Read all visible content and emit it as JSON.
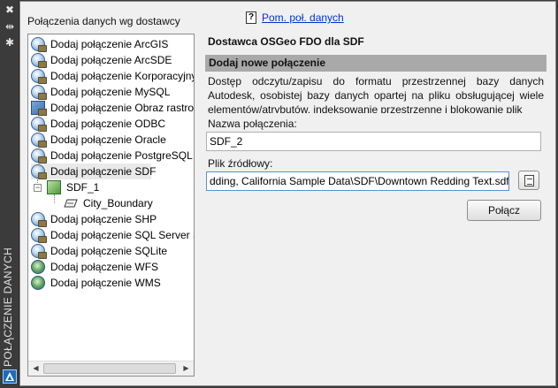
{
  "sidebar_strip": {
    "title": "POŁĄCZENIE DANYCH",
    "icons": [
      "close-icon",
      "auto-hide-icon",
      "settings-icon",
      "autodesk-logo-icon"
    ]
  },
  "tree_panel": {
    "header": "Połączenia danych wg dostawcy",
    "items": [
      {
        "label": "Dodaj połączenie ArcGIS",
        "icon": "database-icon"
      },
      {
        "label": "Dodaj połączenie ArcSDE",
        "icon": "database-icon"
      },
      {
        "label": "Dodaj połączenie Korporacyjny",
        "icon": "database-icon"
      },
      {
        "label": "Dodaj połączenie MySQL",
        "icon": "database-icon"
      },
      {
        "label": "Dodaj połączenie Obraz rastrowy",
        "icon": "raster-icon"
      },
      {
        "label": "Dodaj połączenie ODBC",
        "icon": "database-icon"
      },
      {
        "label": "Dodaj połączenie Oracle",
        "icon": "database-icon"
      },
      {
        "label": "Dodaj połączenie PostgreSQL",
        "icon": "database-icon"
      },
      {
        "label": "Dodaj połączenie SDF",
        "icon": "database-icon",
        "selected": true
      },
      {
        "label": "SDF_1",
        "icon": "sdf-connection-icon",
        "level": 1,
        "expanded": true
      },
      {
        "label": "City_Boundary",
        "icon": "polygon-layer-icon",
        "level": 2
      },
      {
        "label": "Dodaj połączenie SHP",
        "icon": "database-icon"
      },
      {
        "label": "Dodaj połączenie SQL Server Spatial",
        "icon": "database-icon"
      },
      {
        "label": "Dodaj połączenie SQLite",
        "icon": "database-icon"
      },
      {
        "label": "Dodaj połączenie WFS",
        "icon": "globe-icon"
      },
      {
        "label": "Dodaj połączenie WMS",
        "icon": "globe-icon"
      }
    ]
  },
  "help": {
    "label": "Pom. poł. danych",
    "icon": "help-icon"
  },
  "details": {
    "provider_title": "Dostawca OSGeo FDO dla SDF",
    "section_title": "Dodaj nowe połączenie",
    "description": "Dostęp odczytu/zapisu do formatu przestrzennej bazy danych Autodesk, osobistej bazy danych opartej na pliku obsługującej wiele elementów/atrybutów, indeksowanie przestrzenne i blokowanie plik",
    "connection_name_label": "Nazwa połączenia:",
    "connection_name_value": "SDF_2",
    "source_file_label": "Plik źródłowy:",
    "source_file_value": "dding, California Sample Data\\SDF\\Downtown Redding Text.sdf",
    "connect_button": "Połącz"
  },
  "colors": {
    "strip_bg": "#3b3b3b",
    "panel_bg": "#f0f0f0",
    "section_bar": "#a9a9a9",
    "link": "#0033cc"
  }
}
